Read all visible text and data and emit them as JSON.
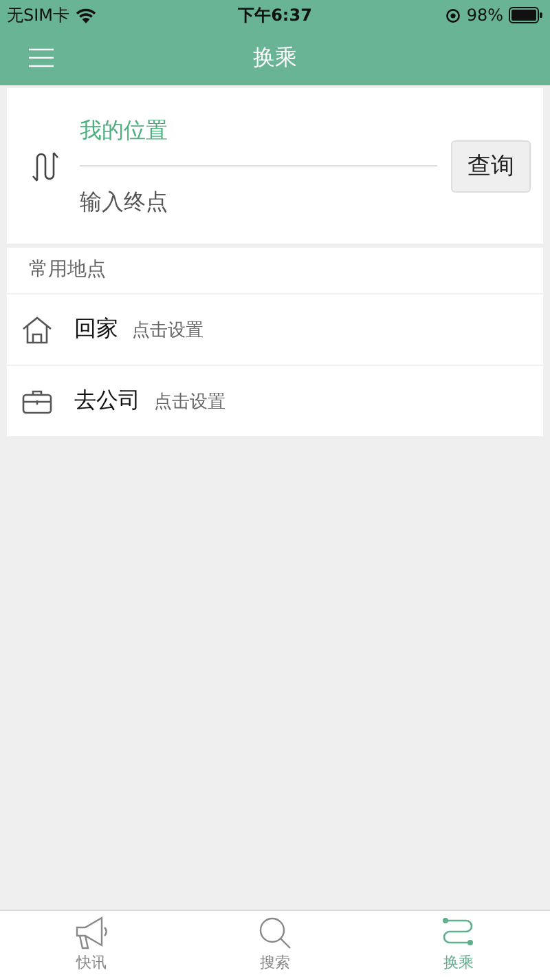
{
  "status_bar": {
    "carrier": "无SIM卡",
    "time": "下午6:37",
    "battery": "98%"
  },
  "nav": {
    "title": "换乘"
  },
  "route": {
    "start": {
      "value": "我的位置"
    },
    "end": {
      "placeholder": "输入终点"
    },
    "query_button": "查询"
  },
  "places": {
    "title": "常用地点",
    "items": [
      {
        "kind": "home",
        "name": "回家",
        "hint": "点击设置"
      },
      {
        "kind": "work",
        "name": "去公司",
        "hint": "点击设置"
      }
    ]
  },
  "tab_bar": [
    {
      "kind": "news",
      "label": "快讯",
      "selected": false
    },
    {
      "kind": "search",
      "label": "搜索",
      "selected": false
    },
    {
      "kind": "transfer",
      "label": "换乘",
      "selected": true
    }
  ]
}
